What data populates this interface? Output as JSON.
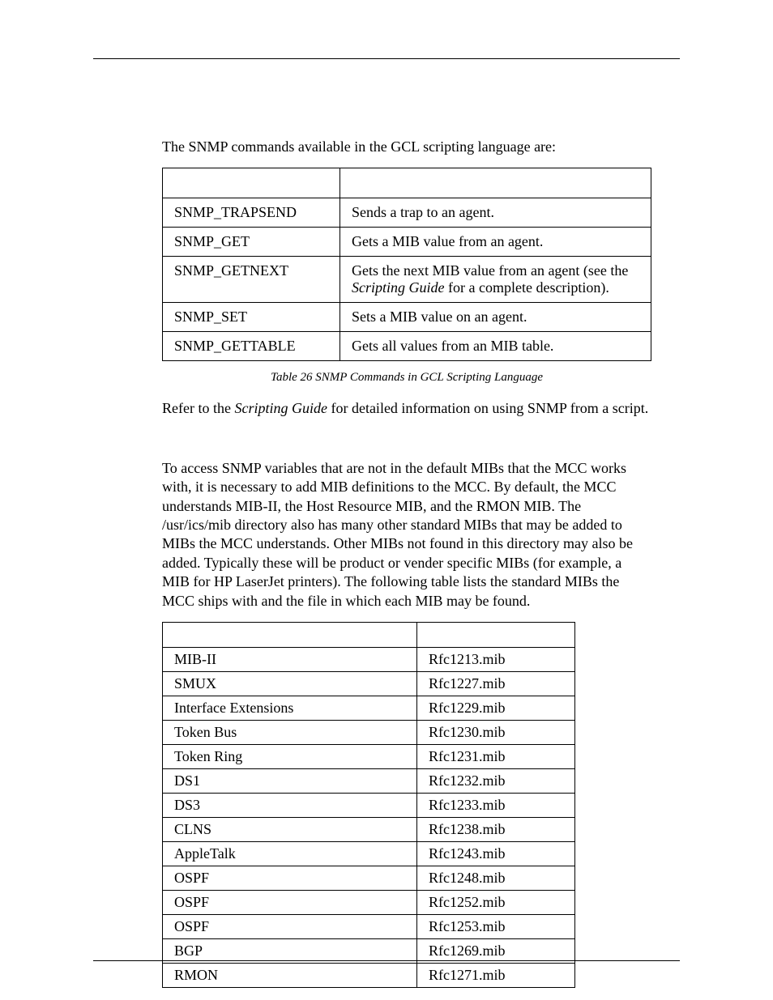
{
  "intro1": "The SNMP commands available in the GCL scripting language are:",
  "table1": {
    "rows": [
      {
        "cmd": "SNMP_TRAPSEND",
        "desc_pre": "Sends a trap to an agent.",
        "desc_i": "",
        "desc_post": ""
      },
      {
        "cmd": "SNMP_GET",
        "desc_pre": "Gets a MIB value from an agent.",
        "desc_i": "",
        "desc_post": ""
      },
      {
        "cmd": "SNMP_GETNEXT",
        "desc_pre": "Gets the next MIB value from an agent (see the ",
        "desc_i": "Scripting Guide",
        "desc_post": " for a complete description)."
      },
      {
        "cmd": "SNMP_SET",
        "desc_pre": "Sets a MIB value on an agent.",
        "desc_i": "",
        "desc_post": ""
      },
      {
        "cmd": "SNMP_GETTABLE",
        "desc_pre": "Gets all values from an MIB table.",
        "desc_i": "",
        "desc_post": ""
      }
    ]
  },
  "caption1": "Table 26 SNMP Commands in GCL Scripting Language",
  "para2_pre": "Refer to the ",
  "para2_i": "Scripting Guide",
  "para2_post": " for detailed information on using SNMP from a script.",
  "para3": "To access SNMP variables that are not in the default MIBs that the MCC works with, it is necessary to add MIB definitions to the MCC. By default, the MCC understands MIB-II, the Host Resource MIB, and the RMON MIB. The /usr/ics/mib directory also has many other standard MIBs that may be added to MIBs the MCC understands. Other MIBs not found in this directory may also be added. Typically these will be product or vender specific MIBs (for example, a MIB for HP LaserJet printers). The following table lists the standard MIBs the MCC ships with and the file in which each MIB may be found.",
  "table2": {
    "rows": [
      {
        "mib": "MIB-II",
        "file": "Rfc1213.mib"
      },
      {
        "mib": "SMUX",
        "file": "Rfc1227.mib"
      },
      {
        "mib": "Interface Extensions",
        "file": "Rfc1229.mib"
      },
      {
        "mib": "Token Bus",
        "file": "Rfc1230.mib"
      },
      {
        "mib": "Token Ring",
        "file": "Rfc1231.mib"
      },
      {
        "mib": "DS1",
        "file": "Rfc1232.mib"
      },
      {
        "mib": "DS3",
        "file": "Rfc1233.mib"
      },
      {
        "mib": "CLNS",
        "file": "Rfc1238.mib"
      },
      {
        "mib": "AppleTalk",
        "file": "Rfc1243.mib"
      },
      {
        "mib": "OSPF",
        "file": "Rfc1248.mib"
      },
      {
        "mib": "OSPF",
        "file": "Rfc1252.mib"
      },
      {
        "mib": "OSPF",
        "file": "Rfc1253.mib"
      },
      {
        "mib": "BGP",
        "file": "Rfc1269.mib"
      },
      {
        "mib": "RMON",
        "file": "Rfc1271.mib"
      }
    ]
  }
}
